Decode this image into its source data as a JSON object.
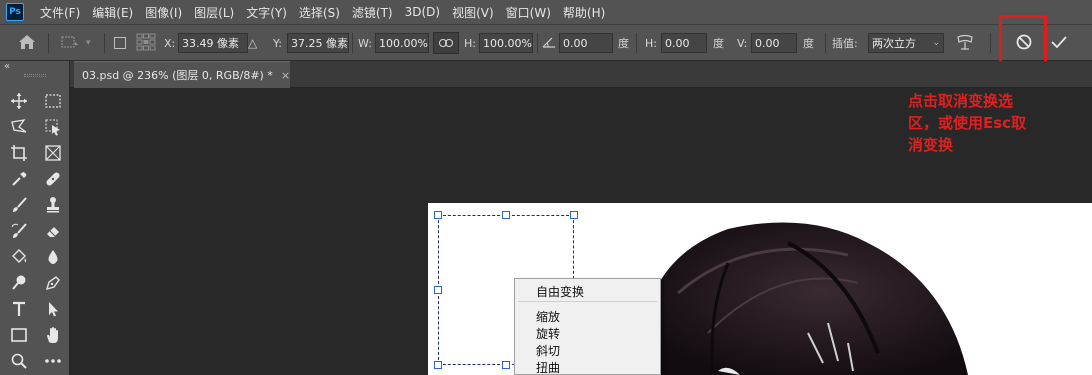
{
  "app": {
    "logo": "Ps",
    "menus": [
      "文件(F)",
      "编辑(E)",
      "图像(I)",
      "图层(L)",
      "文字(Y)",
      "选择(S)",
      "滤镜(T)",
      "3D(D)",
      "视图(V)",
      "窗口(W)",
      "帮助(H)"
    ]
  },
  "options": {
    "x_label": "X:",
    "x_value": "33.49 像素",
    "y_label": "Y:",
    "y_value": "37.25 像素",
    "w_label": "W:",
    "w_value": "100.00%",
    "h_label": "H:",
    "h_value": "100.00%",
    "rotate_value": "0.00",
    "rotate_unit": "度",
    "hskew_label": "H:",
    "hskew_value": "0.00",
    "hskew_unit": "度",
    "vskew_label": "V:",
    "vskew_value": "0.00",
    "vskew_unit": "度",
    "interp_label": "插值:",
    "interp_value": "两次立方"
  },
  "tab": {
    "title": "03.psd @ 236% (图层 0, RGB/8#) *",
    "close": "×"
  },
  "context_menu": {
    "items": [
      "自由变换",
      "缩放",
      "旋转",
      "斜切",
      "扭曲"
    ]
  },
  "annotation": {
    "line1": "点击取消变换选",
    "line2": "区，或使用Esc取",
    "line3": "消变换"
  },
  "colors": {
    "highlight": "#e31b1b",
    "annotation": "#e02020",
    "handle_border": "#2a63d5"
  },
  "icons": {
    "cancel": "cancel-icon",
    "commit": "check-icon"
  }
}
